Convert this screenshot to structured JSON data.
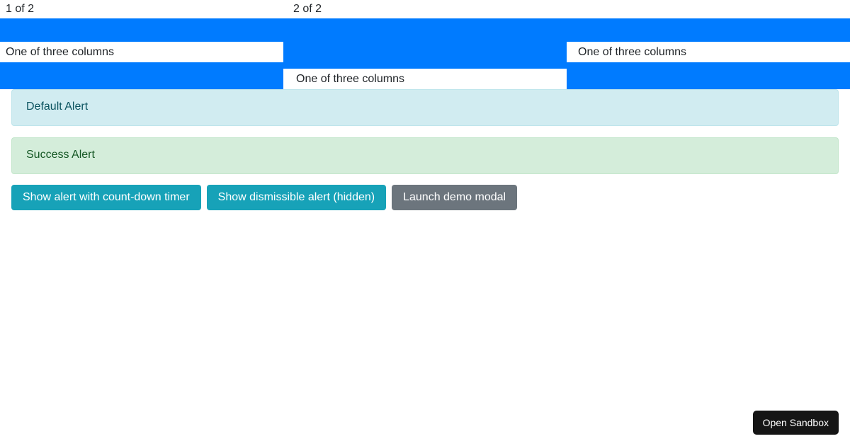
{
  "carousel": {
    "indicators": [
      {
        "label": "1 of 2"
      },
      {
        "label": "2 of 2"
      }
    ],
    "background_color": "#007bff",
    "columns": [
      {
        "text": "One of three columns"
      },
      {
        "text": "One of three columns"
      },
      {
        "text": "One of three columns"
      }
    ]
  },
  "alerts": [
    {
      "text": "Default Alert",
      "background_color": "#d1ecf1",
      "border_color": "#bee5eb",
      "text_color": "#0c5460"
    },
    {
      "text": "Success Alert",
      "background_color": "#d4edda",
      "border_color": "#c3e6cb",
      "text_color": "#155724"
    }
  ],
  "buttons": [
    {
      "label": "Show alert with count-down timer",
      "color": "#17a2b8"
    },
    {
      "label": "Show dismissible alert (hidden)",
      "color": "#17a2b8"
    },
    {
      "label": "Launch demo modal",
      "color": "#6c757d"
    }
  ],
  "sandbox": {
    "label": "Open Sandbox",
    "background_color": "#151515"
  }
}
